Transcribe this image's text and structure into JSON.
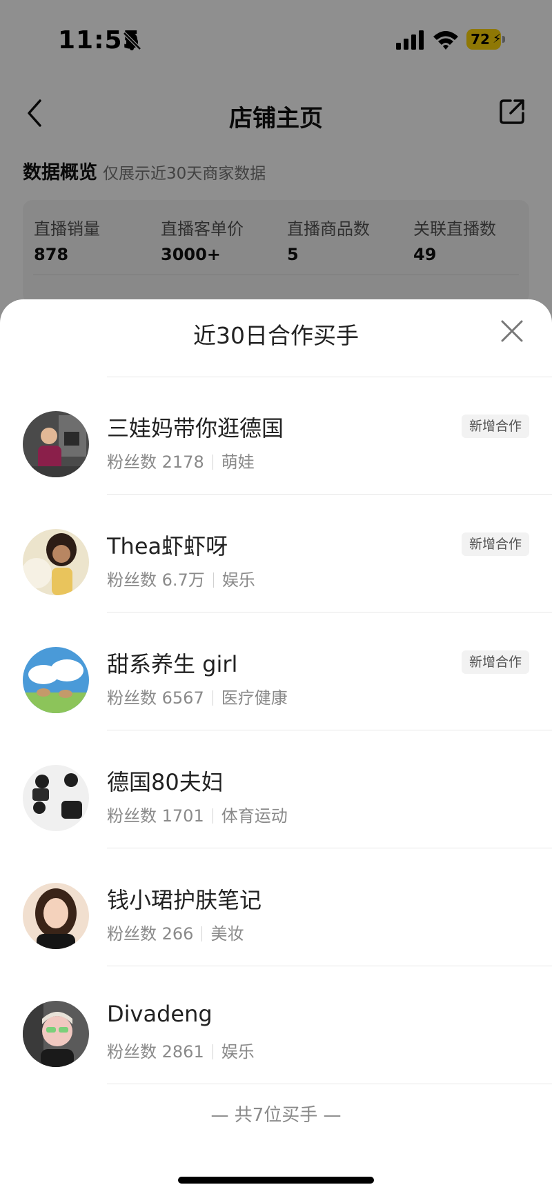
{
  "status_bar": {
    "time": "11:55",
    "battery": "72"
  },
  "nav": {
    "title": "店铺主页"
  },
  "overview": {
    "title": "数据概览",
    "subtitle": "仅展示近30天商家数据",
    "stats": [
      {
        "label": "直播销量",
        "value": "878"
      },
      {
        "label": "直播客单价",
        "value": "3000+"
      },
      {
        "label": "直播商品数",
        "value": "5"
      },
      {
        "label": "关联直播数",
        "value": "49"
      }
    ]
  },
  "sheet": {
    "title": "近30日合作买手",
    "fans_label": "粉丝数",
    "badge_label": "新增合作",
    "buyers": [
      {
        "name": "三娃妈带你逛德国",
        "fans": "2178",
        "category": "萌娃",
        "badge": true
      },
      {
        "name": "Thea虾虾呀",
        "fans": "6.7万",
        "category": "娱乐",
        "badge": true
      },
      {
        "name": "甜系养生 girl",
        "fans": "6567",
        "category": "医疗健康",
        "badge": true
      },
      {
        "name": "德国80夫妇",
        "fans": "1701",
        "category": "体育运动",
        "badge": false
      },
      {
        "name": "钱小珺护肤笔记",
        "fans": "266",
        "category": "美妆",
        "badge": false
      },
      {
        "name": "Divadeng",
        "fans": "2861",
        "category": "娱乐",
        "badge": false
      }
    ],
    "footer": "— 共7位买手 —"
  }
}
